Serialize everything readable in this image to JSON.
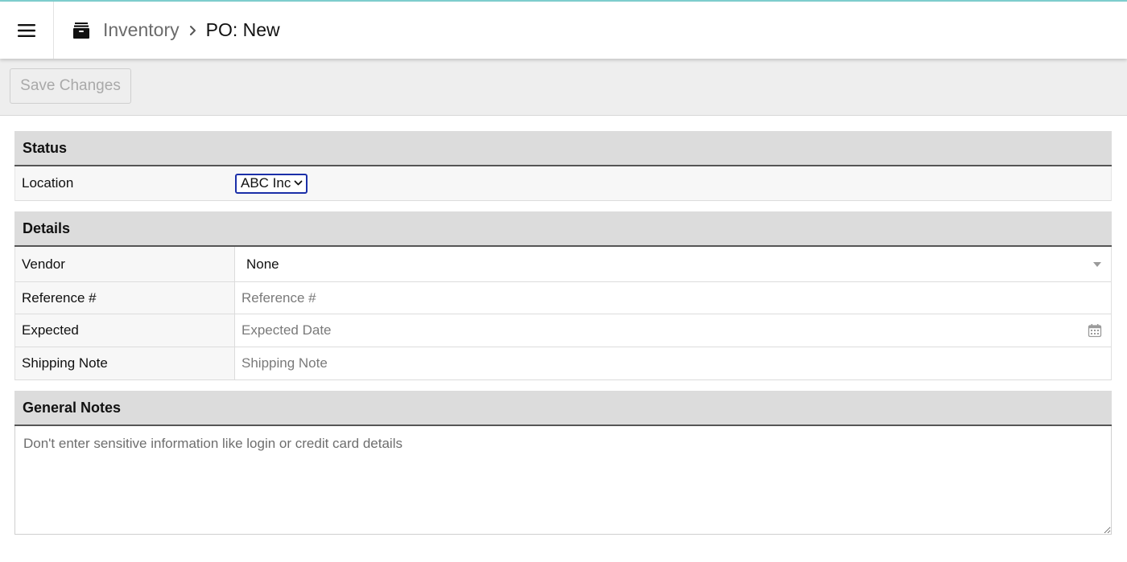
{
  "header": {
    "breadcrumb_parent": "Inventory",
    "breadcrumb_current": "PO: New",
    "breadcrumb_separator": "›"
  },
  "toolbar": {
    "save_label": "Save Changes"
  },
  "status_section": {
    "title": "Status",
    "location_label": "Location",
    "location_value": "ABC Inc"
  },
  "details_section": {
    "title": "Details",
    "vendor_label": "Vendor",
    "vendor_value": "None",
    "reference_label": "Reference #",
    "reference_placeholder": "Reference #",
    "expected_label": "Expected",
    "expected_placeholder": "Expected Date",
    "shipping_label": "Shipping Note",
    "shipping_placeholder": "Shipping Note"
  },
  "notes_section": {
    "title": "General Notes",
    "placeholder": "Don't enter sensitive information like login or credit card details"
  },
  "colors": {
    "accent_line": "#7fcfcf",
    "select_focus": "#1b2fa8",
    "section_bg": "#dcdcdc"
  },
  "icons": {
    "menu": "hamburger-menu-icon",
    "breadcrumb_root": "archive-box-icon",
    "separator": "chevron-right-icon",
    "location_dropdown": "chevron-down-icon",
    "vendor_dropdown": "caret-down-icon",
    "date": "calendar-icon"
  }
}
